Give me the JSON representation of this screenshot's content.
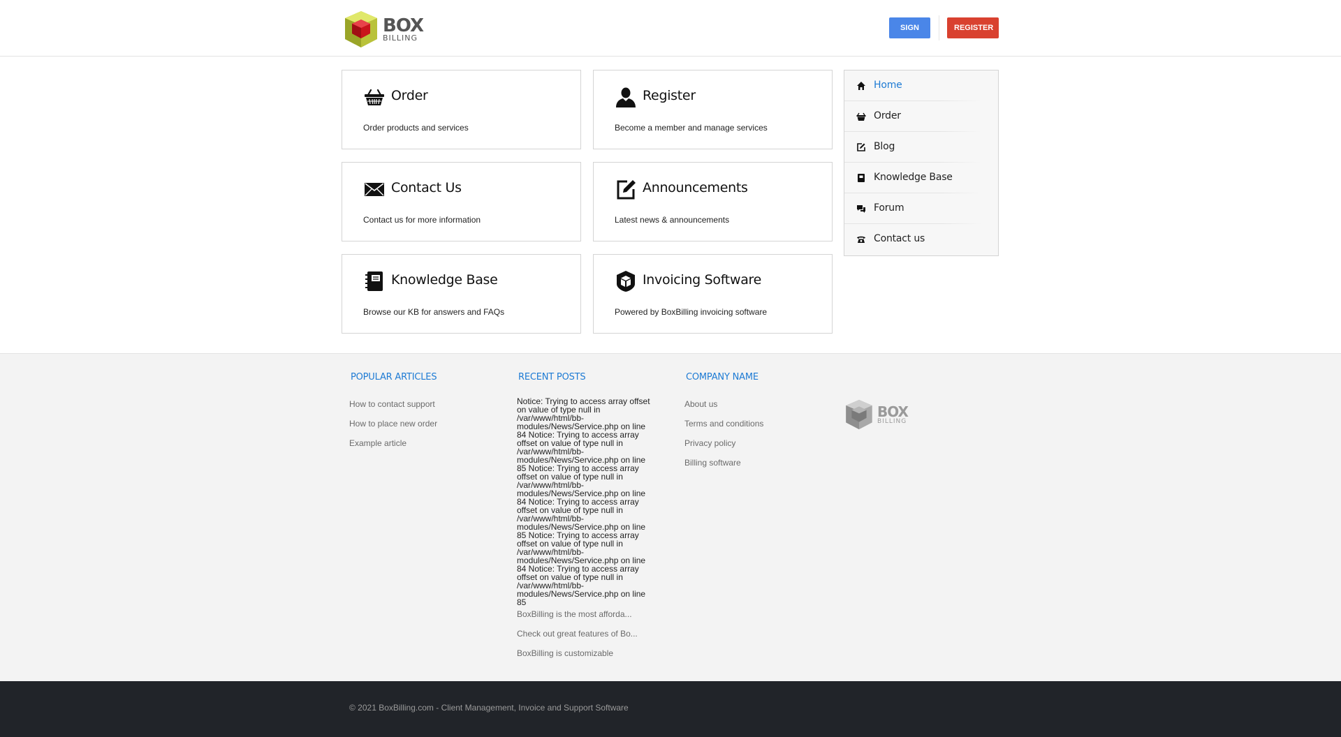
{
  "header": {
    "logo_text": "BOX",
    "logo_sub": "BILLING",
    "signin_label": "SIGN IN",
    "register_label": "REGISTER"
  },
  "tiles": [
    {
      "title": "Order",
      "desc": "Order products and services",
      "icon": "basket-icon"
    },
    {
      "title": "Register",
      "desc": "Become a member and manage services",
      "icon": "user-icon"
    },
    {
      "title": "Contact Us",
      "desc": "Contact us for more information",
      "icon": "envelope-icon"
    },
    {
      "title": "Announcements",
      "desc": "Latest news & announcements",
      "icon": "edit-icon"
    },
    {
      "title": "Knowledge Base",
      "desc": "Browse our KB for answers and FAQs",
      "icon": "book-icon"
    },
    {
      "title": "Invoicing Software",
      "desc": "Powered by BoxBilling invoicing software",
      "icon": "cube-icon"
    }
  ],
  "sidenav": {
    "items": [
      {
        "label": "Home",
        "icon": "home-icon",
        "active": true
      },
      {
        "label": "Order",
        "icon": "basket-icon"
      },
      {
        "label": "Blog",
        "icon": "edit-icon"
      },
      {
        "label": "Knowledge Base",
        "icon": "book-icon"
      },
      {
        "label": "Forum",
        "icon": "chat-icon"
      },
      {
        "label": "Contact us",
        "icon": "phone-icon"
      }
    ]
  },
  "footer": {
    "popular": {
      "heading": "Popular Articles",
      "links": [
        "How to contact support",
        "How to place new order",
        "Example article"
      ]
    },
    "recent": {
      "heading": "Recent Posts",
      "notice": "Notice: Trying to access array offset on value of type null in /var/www/html/bb-modules/News/Service.php on line 84 Notice: Trying to access array offset on value of type null in /var/www/html/bb-modules/News/Service.php on line 85 Notice: Trying to access array offset on value of type null in /var/www/html/bb-modules/News/Service.php on line 84 Notice: Trying to access array offset on value of type null in /var/www/html/bb-modules/News/Service.php on line 85 Notice: Trying to access array offset on value of type null in /var/www/html/bb-modules/News/Service.php on line 84 Notice: Trying to access array offset on value of type null in /var/www/html/bb-modules/News/Service.php on line 85",
      "links": [
        "BoxBilling is the most afforda...",
        "Check out great features of Bo...",
        "BoxBilling is customizable"
      ]
    },
    "company": {
      "heading": "Company Name",
      "links": [
        "About us",
        "Terms and conditions",
        "Privacy policy",
        "Billing software"
      ]
    },
    "logo_text": "BOX",
    "logo_sub": "BILLING"
  },
  "copyright": "© 2021 BoxBilling.com - Client Management, Invoice and Support Software",
  "colors": {
    "accent": "#1e7bd4",
    "signin": "#4a86e8",
    "register": "#d9412f",
    "bottombar": "#212429"
  }
}
